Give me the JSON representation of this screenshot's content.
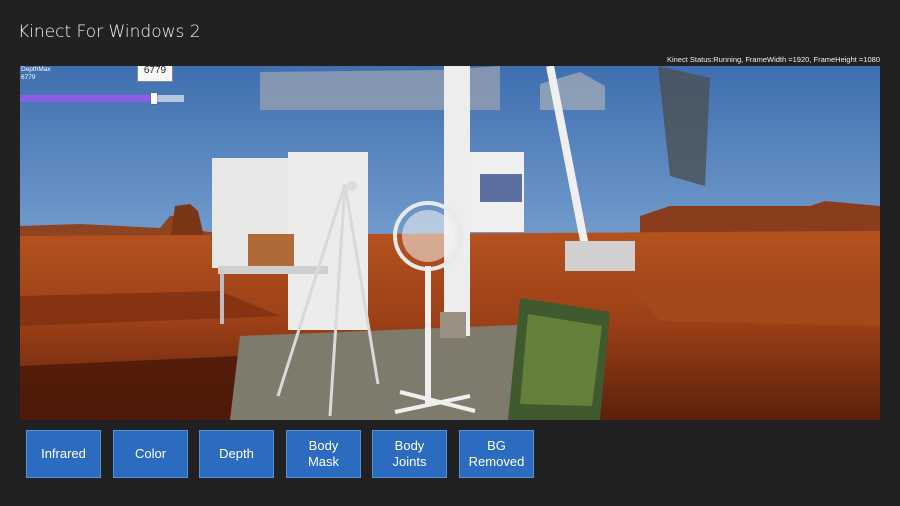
{
  "app": {
    "title": "Kinect For Windows 2",
    "status": "Kinect Status:Running, FrameWidth =1920, FrameHeight =1080"
  },
  "depth_slider": {
    "label": "DepthMax",
    "value_text": "6779",
    "tooltip": "6779",
    "fraction": 0.82
  },
  "buttons": [
    {
      "id": "infrared",
      "lines": [
        "Infrared"
      ]
    },
    {
      "id": "color",
      "lines": [
        "Color"
      ]
    },
    {
      "id": "depth",
      "lines": [
        "Depth"
      ]
    },
    {
      "id": "body-mask",
      "lines": [
        "Body",
        "Mask"
      ]
    },
    {
      "id": "body-joints",
      "lines": [
        "Body",
        "Joints"
      ]
    },
    {
      "id": "bg-removed",
      "lines": [
        "BG",
        "Removed"
      ]
    }
  ],
  "colors": {
    "background": "#212121",
    "button_fill": "#2b6cc0",
    "slider_fill": "#8a5fe6",
    "slider_track": "#b7c8e0"
  }
}
